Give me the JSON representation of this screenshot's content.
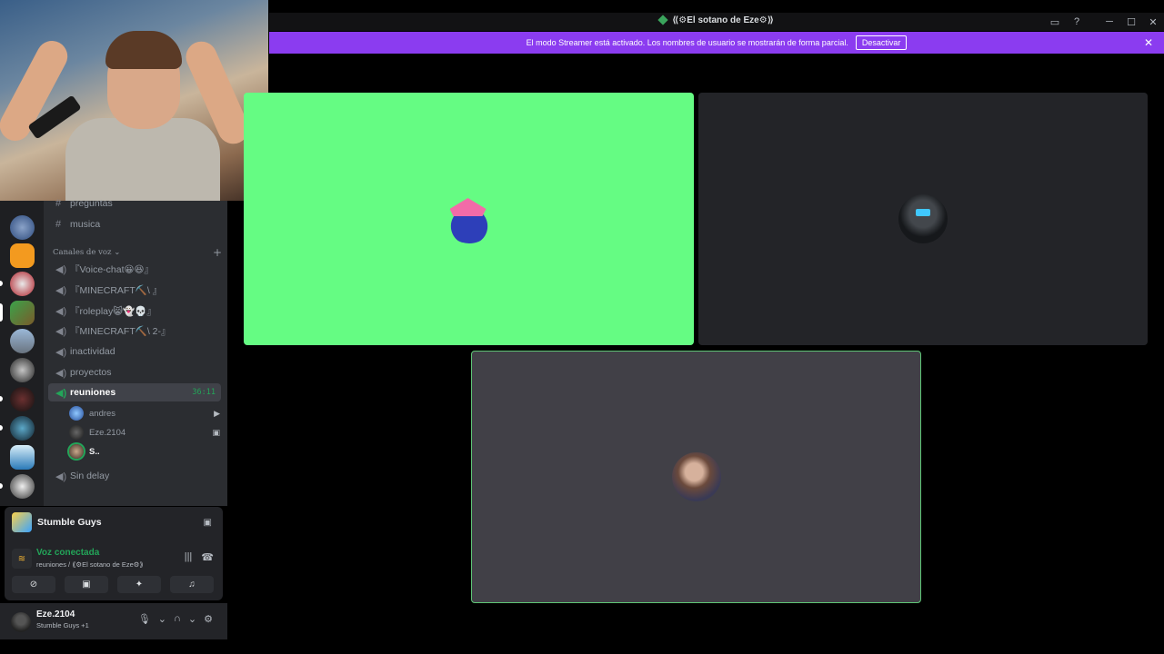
{
  "window": {
    "title": "⟪⚙El sotano de Eze⚙⟫",
    "controls": [
      "─",
      "☐",
      "✕"
    ]
  },
  "banner": {
    "text": "El modo Streamer está activado. Los nombres de usuario se mostrarán de forma parcial.",
    "button": "Desactivar"
  },
  "sidebar": {
    "text_channels": [
      "preguntas",
      "musica"
    ],
    "voice_category": "Canales de voz",
    "voice_channels": [
      "『Voice-chat😀😆』",
      "『MINECRAFT⛏️\\ 』",
      "『roleplay😸👻💀』",
      "『MINECRAFT⛏️\\ 2-』",
      "inactividad",
      "proyectos"
    ],
    "active_channel": {
      "name": "reuniones",
      "time": "36:11"
    },
    "members": [
      {
        "name": "andres",
        "side": "▶"
      },
      {
        "name": "Eze.2104",
        "side": "▣"
      },
      {
        "name": "S..",
        "side": ""
      }
    ],
    "after_channel": "Sin delay"
  },
  "activity": {
    "name": "Stumble Guys"
  },
  "voice": {
    "state": "Voz conectada",
    "path": "reuniones / ⟪⚙El sotano de Eze⚙⟫"
  },
  "user": {
    "name": "Eze.2104",
    "status": "Stumble Guys +1"
  },
  "colors": {
    "banner": "#8b3cf0",
    "green_tile": "#65fc83",
    "voice_green": "#23a559"
  }
}
